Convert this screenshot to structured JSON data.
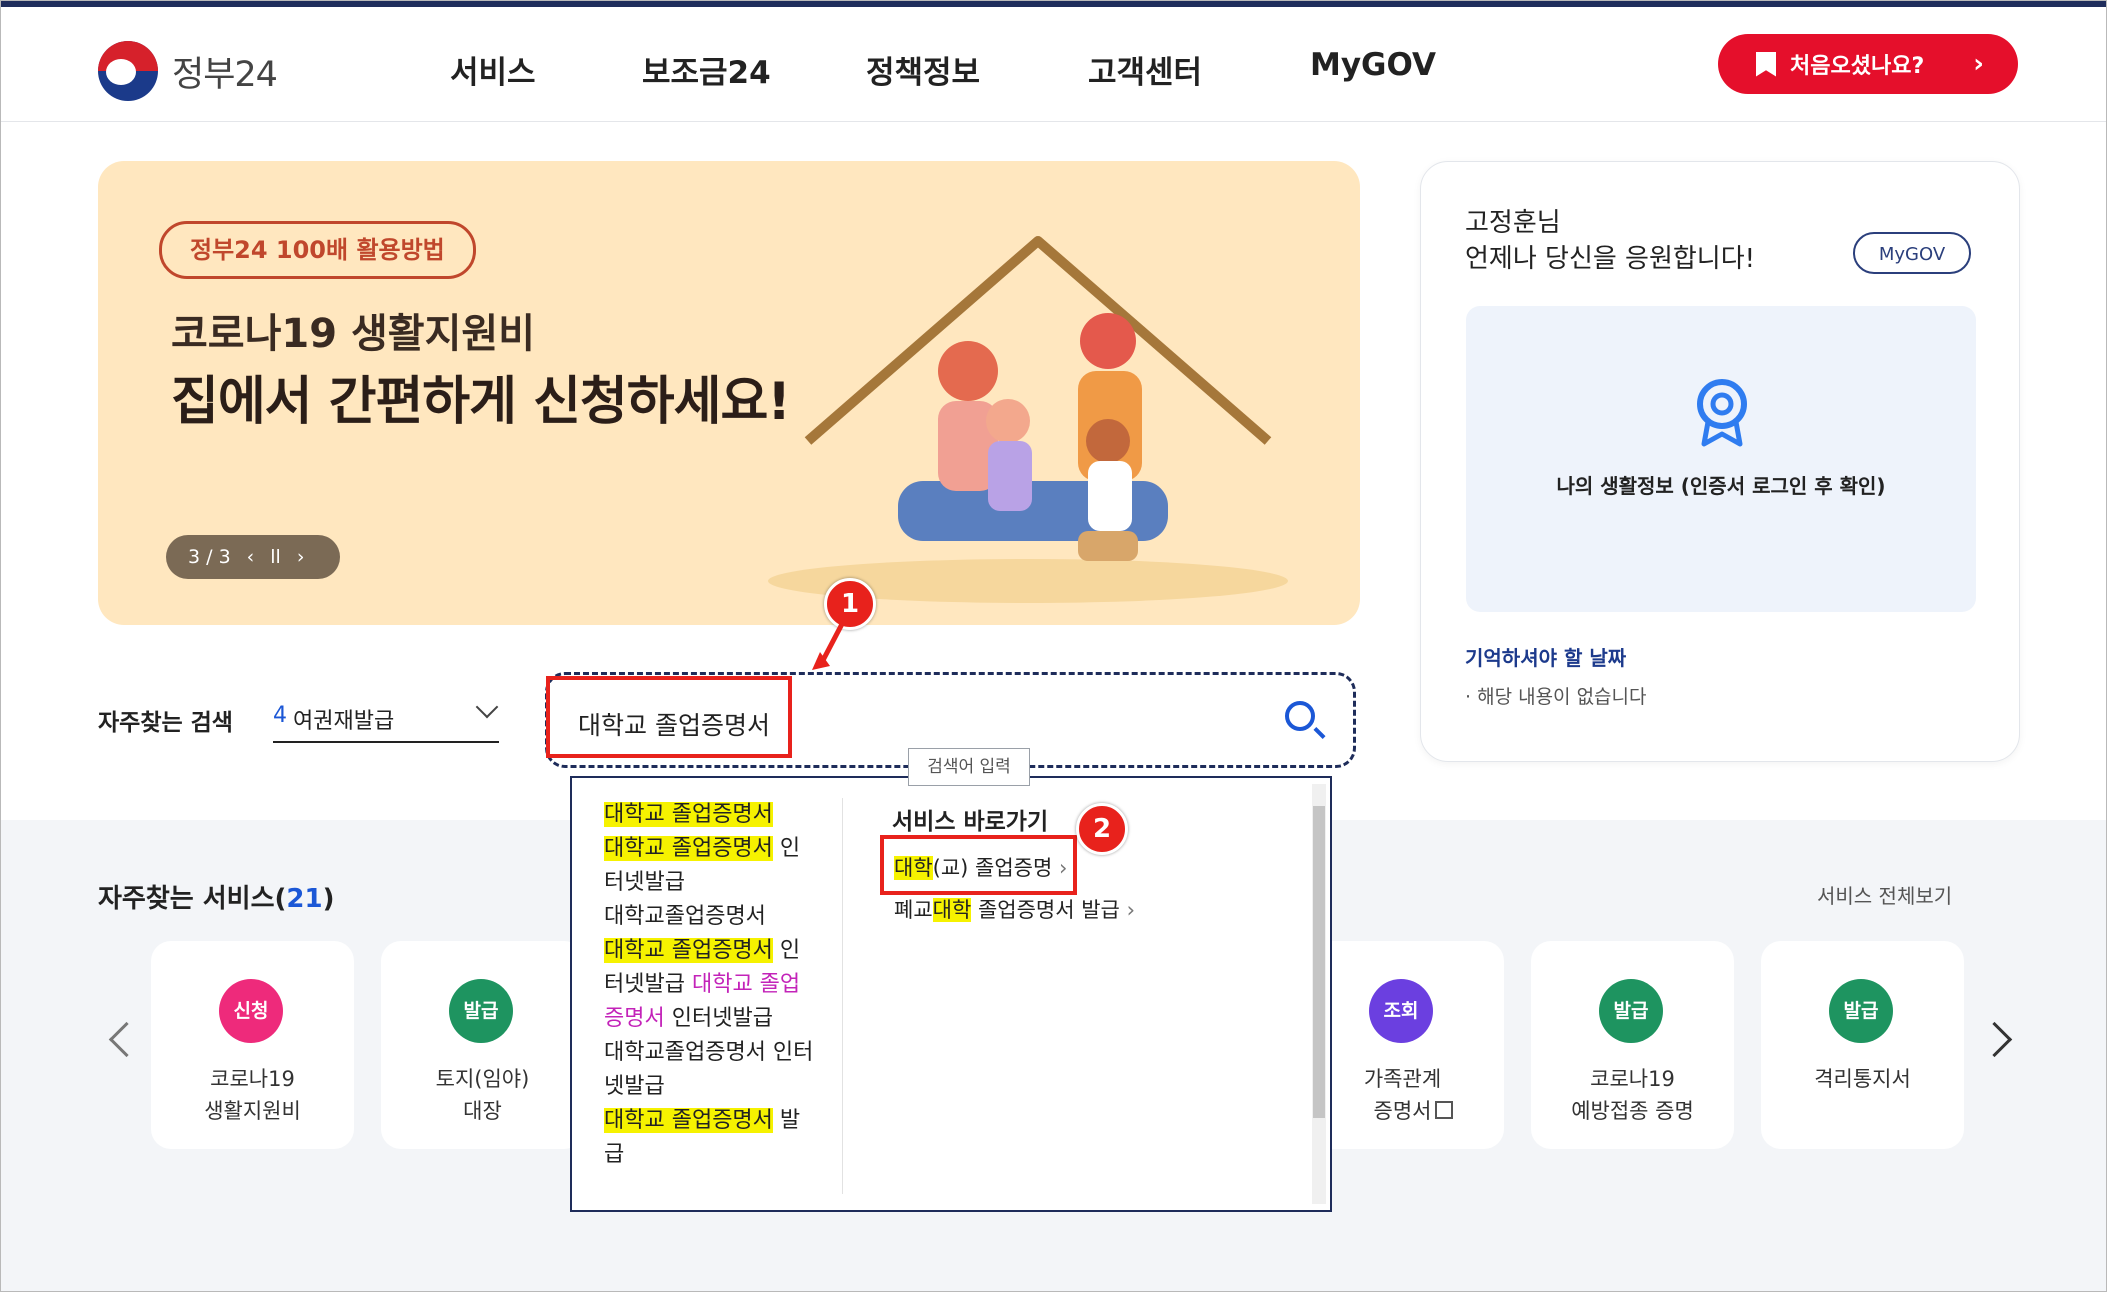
{
  "header": {
    "logo_text": "정부24",
    "nav": [
      "서비스",
      "보조금24",
      "정책정보",
      "고객센터",
      "MyGOV"
    ],
    "first_visit_button": "처음오셨나요?"
  },
  "banner": {
    "pill": "정부24 100배 활용방법",
    "line1": "코로나19 생활지원비",
    "line2": "집에서 간편하게 신청하세요!",
    "pager": "3 / 3"
  },
  "side": {
    "greet_name": "고정훈님",
    "greet_msg": "언제나 당신을 응원합니다!",
    "mygov_button": "MyGOV",
    "life_info": "나의 생활정보 (인증서 로그인 후 확인)",
    "remember_title": "기억하셔야 할 날짜",
    "remember_empty": "해당 내용이 없습니다"
  },
  "search": {
    "freq_label": "자주찾는 검색",
    "freq_num": "4",
    "freq_value": "여권재발급",
    "query": "대학교 졸업증명서",
    "tooltip": "검색어 입력"
  },
  "dropdown": {
    "right_title": "서비스 바로가기",
    "link1_hl": "대학",
    "link1_rest": "(교) 졸업증명",
    "link2_pre": "폐교",
    "link2_hl": "대학",
    "link2_rest": " 졸업증명서 발급",
    "suggestions": {
      "s1": "대학교 졸업증명서",
      "s2_hl": "대학교 졸업증명서",
      "s2_rest": " 인터넷발급",
      "s3": "대학교졸업증명서",
      "s4_hl": "대학교 졸업증명서",
      "s4_mid": " 인터넷발급 ",
      "s4_pink": "대학교 졸업증명서",
      "s4_rest": " 인터넷발급",
      "s5": "대학교졸업증명서 인터넷발급",
      "s6_hl": "대학교 졸업증명서",
      "s6_rest": " 발급"
    }
  },
  "services": {
    "title": "자주찾는 서비스(",
    "count": "21",
    "title_end": ")",
    "all": "서비스 전체보기",
    "cards": [
      {
        "badge": "신청",
        "color": "#ee2a7b",
        "label": "코로나19\n생활지원비"
      },
      {
        "badge": "발급",
        "color": "#1e9460",
        "label": "토지(임야)\n대장"
      },
      {
        "badge": "조회",
        "color": "#6b3fe0",
        "label": "가족관계\n증명서"
      },
      {
        "badge": "발급",
        "color": "#1e9460",
        "label": "코로나19\n예방접종 증명"
      },
      {
        "badge": "발급",
        "color": "#1e9460",
        "label": "격리통지서"
      }
    ]
  },
  "annotations": {
    "one": "1",
    "two": "2"
  }
}
